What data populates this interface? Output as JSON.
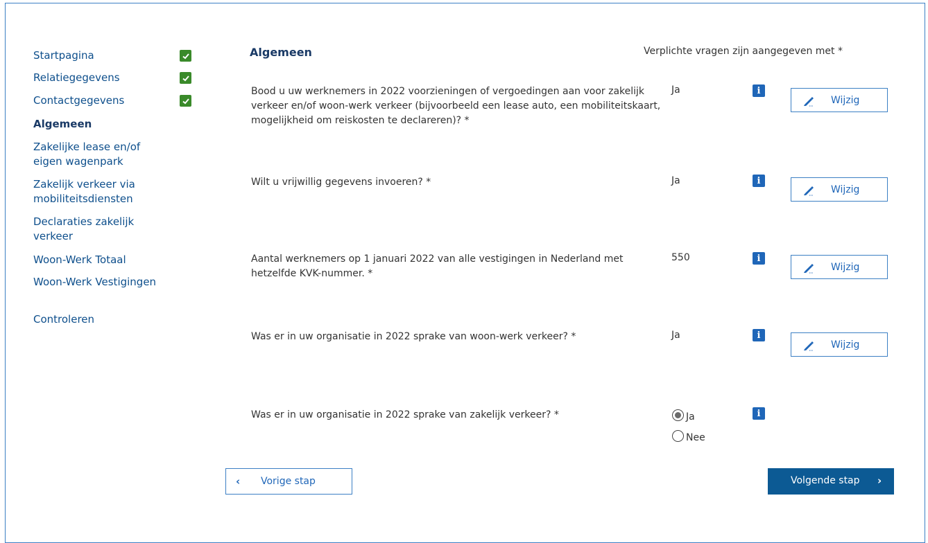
{
  "sidebar": {
    "items": [
      {
        "label": "Startpagina",
        "done": true
      },
      {
        "label": "Relatiegegevens",
        "done": true
      },
      {
        "label": "Contactgegevens",
        "done": true
      },
      {
        "label": "Algemeen",
        "active": true
      },
      {
        "label": "Zakelijke lease en/of eigen wagenpark"
      },
      {
        "label": "Zakelijk verkeer via mobiliteitsdiensten"
      },
      {
        "label": "Declaraties zakelijk verkeer"
      },
      {
        "label": "Woon-Werk Totaal"
      },
      {
        "label": "Woon-Werk Vestigingen"
      },
      {
        "label": "Controleren"
      }
    ]
  },
  "main": {
    "title": "Algemeen",
    "required_note": "Verplichte vragen zijn aangegeven met *",
    "questions": [
      {
        "text": "Bood u uw werknemers in 2022 voorzieningen of vergoedingen aan voor zakelijk verkeer en/of woon-werk verkeer (bijvoorbeeld een lease auto, een mobiliteitskaart, mogelijkheid om reiskosten te declareren)? *",
        "answer": "Ja",
        "edit_label": "Wijzig"
      },
      {
        "text": "Wilt u vrijwillig gegevens invoeren? *",
        "answer": "Ja",
        "edit_label": "Wijzig"
      },
      {
        "text": "Aantal werknemers op 1 januari 2022 van alle vestigingen in Nederland met hetzelfde KVK-nummer. *",
        "answer": "550",
        "edit_label": "Wijzig"
      },
      {
        "text": "Was er in uw organisatie in 2022 sprake van woon-werk verkeer? *",
        "answer": "Ja",
        "edit_label": "Wijzig"
      },
      {
        "text": "Was er in uw organisatie in 2022 sprake van zakelijk verkeer? *",
        "options": [
          "Ja",
          "Nee"
        ],
        "selected": "Ja"
      }
    ],
    "info_glyph": "i"
  },
  "nav": {
    "prev_label": "Vorige stap",
    "next_label": "Volgende stap"
  },
  "colors": {
    "accent": "#1f66b8",
    "primary_button": "#0c5a94",
    "check_green": "#3a8a2a",
    "heading": "#1a3a66"
  }
}
